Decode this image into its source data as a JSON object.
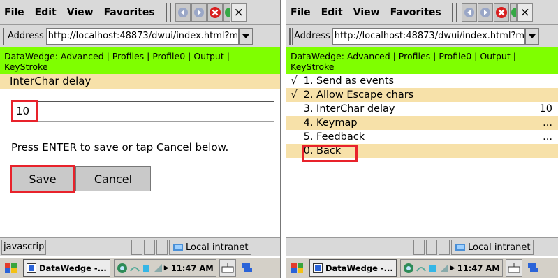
{
  "menu": {
    "file": "File",
    "edit": "Edit",
    "view": "View",
    "favorites": "Favorites",
    "close": "×"
  },
  "address": {
    "label": "Address",
    "url": "http://localhost:48873/dwui/index.html?m"
  },
  "breadcrumb": "DataWedge: Advanced | Profiles | Profile0 | Output | KeyStroke",
  "left": {
    "section_title": "InterChar delay",
    "value": "10",
    "instruction": "Press ENTER to save or tap Cancel below.",
    "save_label": "Save",
    "cancel_label": "Cancel",
    "status_text": "javascript:"
  },
  "right": {
    "items": [
      {
        "check": "√",
        "label": "1.  Send as events",
        "value": ""
      },
      {
        "check": "√",
        "label": "2.  Allow Escape chars",
        "value": ""
      },
      {
        "check": "",
        "label": "3.  InterChar delay",
        "value": "10"
      },
      {
        "check": "",
        "label": "4.  Keymap",
        "value": "..."
      },
      {
        "check": "",
        "label": "5.  Feedback",
        "value": "..."
      },
      {
        "check": "",
        "label": "0.  Back",
        "value": ""
      }
    ]
  },
  "status": {
    "zone": "Local intranet"
  },
  "taskbar": {
    "task_label": "DataWedge -...",
    "time": "11:47 AM"
  },
  "colors": {
    "breadcrumb_bg": "#7fff00",
    "row_highlight": "#f7e1a9",
    "callout": "#e8222b"
  }
}
